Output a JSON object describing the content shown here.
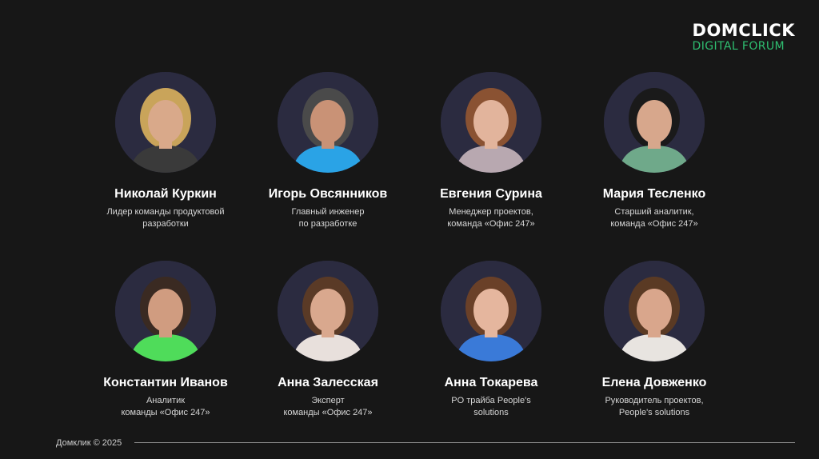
{
  "logo": {
    "top": "DOMCLICK",
    "bottom": "DIGITAL FORUM"
  },
  "speakers": [
    {
      "name": "Николай Куркин",
      "role": "Лидер команды продуктовой\nразработки",
      "hair": "#c9a45a",
      "shirt": "#3a3a3a",
      "skin": "#d9a98a"
    },
    {
      "name": "Игорь Овсянников",
      "role": "Главный инженер\nпо разработке",
      "hair": "#4a4a4a",
      "shirt": "#2aa3e6",
      "skin": "#c99276"
    },
    {
      "name": "Евгения Сурина",
      "role": "Менеджер проектов,\nкоманда «Офис 247»",
      "hair": "#8a5232",
      "shirt": "#b8a8b0",
      "skin": "#e2b49c"
    },
    {
      "name": "Мария Тесленко",
      "role": "Старший аналитик,\nкоманда «Офис 247»",
      "hair": "#1a1a1a",
      "shirt": "#6fa98a",
      "skin": "#d7a78c"
    },
    {
      "name": "Константин Иванов",
      "role": "Аналитик\nкоманды «Офис 247»",
      "hair": "#3a2a22",
      "shirt": "#4fdc5a",
      "skin": "#d09c80"
    },
    {
      "name": "Анна Залесская",
      "role": "Эксперт\nкоманды «Офис 247»",
      "hair": "#5a3a26",
      "shirt": "#e8e0dc",
      "skin": "#d9a88e"
    },
    {
      "name": "Анна Токарева",
      "role": "PO трайба People's\nsolutions",
      "hair": "#6a4028",
      "shirt": "#3a7ad8",
      "skin": "#e5b69e"
    },
    {
      "name": "Елена Довженко",
      "role": "Руководитель проектов,\nPeople's solutions",
      "hair": "#5a3a24",
      "shirt": "#e8e4e0",
      "skin": "#d9a68c"
    }
  ],
  "footer": {
    "text": "Домклик © 2025"
  }
}
